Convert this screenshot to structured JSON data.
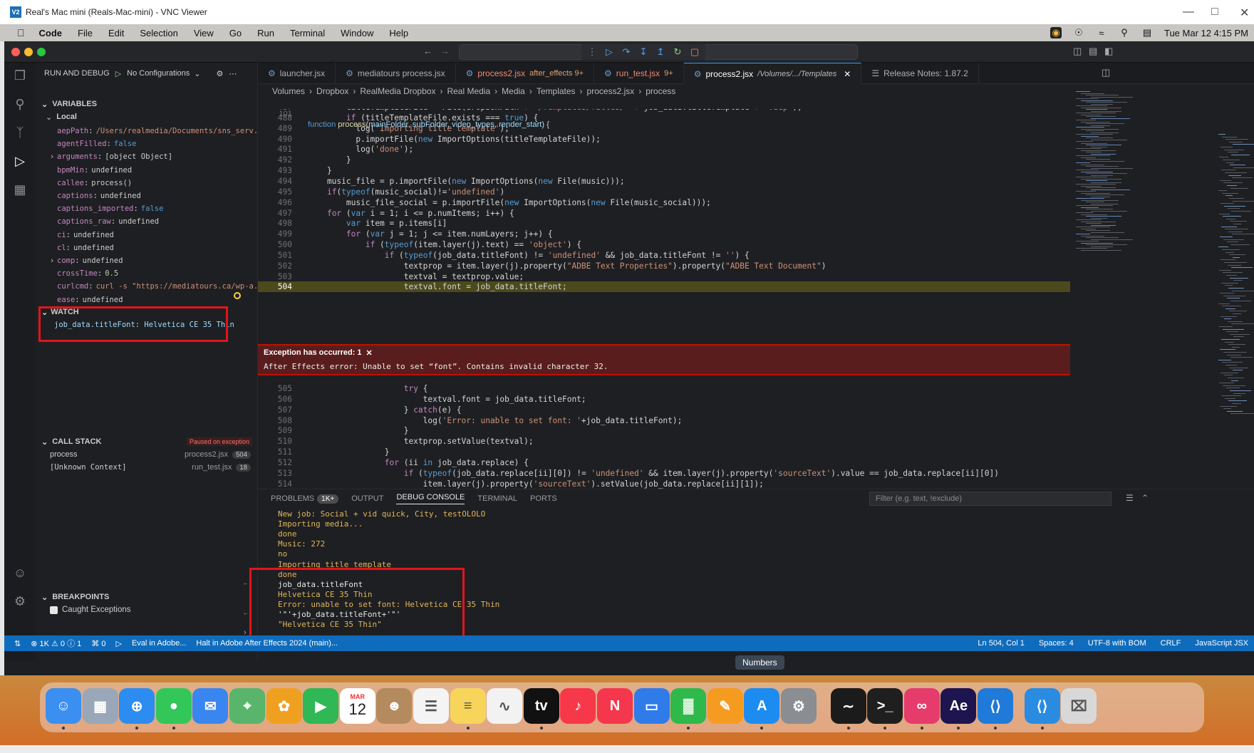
{
  "vnc": {
    "title": "Real's Mac mini (Reals-Mac-mini) - VNC Viewer",
    "logo": "V2"
  },
  "menubar": {
    "items": [
      "Code",
      "File",
      "Edit",
      "Selection",
      "View",
      "Go",
      "Run",
      "Terminal",
      "Window",
      "Help"
    ],
    "datetime": "Tue Mar 12  4:15 PM"
  },
  "sidebar": {
    "header": "RUN AND DEBUG",
    "config": "No Configurations",
    "variables_title": "VARIABLES",
    "local_title": "Local",
    "variables": [
      {
        "name": "aepPath",
        "value": "/Users/realmedia/Documents/sns_serv...",
        "kind": "str"
      },
      {
        "name": "agentFilled",
        "value": "false",
        "kind": "bool"
      },
      {
        "name": "arguments",
        "value": "[object Object]",
        "kind": "obj"
      },
      {
        "name": "bpmMin",
        "value": "undefined",
        "kind": "obj"
      },
      {
        "name": "callee",
        "value": "process()",
        "kind": "obj"
      },
      {
        "name": "captions",
        "value": "undefined",
        "kind": "obj"
      },
      {
        "name": "captions_imported",
        "value": "false",
        "kind": "bool"
      },
      {
        "name": "captions_raw",
        "value": "undefined",
        "kind": "obj"
      },
      {
        "name": "ci",
        "value": "undefined",
        "kind": "obj"
      },
      {
        "name": "cl",
        "value": "undefined",
        "kind": "obj"
      },
      {
        "name": "comp",
        "value": "undefined",
        "kind": "obj"
      },
      {
        "name": "crossTime",
        "value": "0.5",
        "kind": "num"
      },
      {
        "name": "curlcmd",
        "value": "curl -s \"https://mediatours.ca/wp-a...",
        "kind": "str"
      },
      {
        "name": "ease",
        "value": "undefined",
        "kind": "obj"
      }
    ],
    "watch_title": "WATCH",
    "watch_item": "job_data.titleFont: Helvetica CE 35 Thin",
    "callstack_title": "CALL STACK",
    "paused_label": "Paused on exception",
    "callstack": [
      {
        "name": "process",
        "file": "process2.jsx",
        "line": "504"
      },
      {
        "name": "[Unknown Context]",
        "file": "run_test.jsx",
        "line": "18"
      }
    ],
    "breakpoints_title": "BREAKPOINTS",
    "caught_exceptions": "Caught Exceptions"
  },
  "tabs": [
    {
      "label": "launcher.jsx",
      "sub": "",
      "err": false
    },
    {
      "label": "mediatours process.jsx",
      "sub": "",
      "err": false
    },
    {
      "label": "process2.jsx",
      "sub": "after_effects 9+",
      "err": true
    },
    {
      "label": "run_test.jsx",
      "sub": "9+",
      "err": true
    },
    {
      "label": "process2.jsx",
      "sub": "/Volumes/.../Templates",
      "err": false,
      "active": true
    },
    {
      "label": "Release Notes: 1.87.2",
      "sub": "",
      "err": false
    }
  ],
  "breadcrumb": [
    "Volumes",
    "Dropbox",
    "RealMedia Dropbox",
    "Real Media",
    "Media",
    "Templates",
    "process2.jsx",
    "process"
  ],
  "sticky_line": {
    "ln": "101",
    "html": "<span class='k'>function</span> <span class='fn'>process</span>(<span class='v'>mainFolder</span>, <span class='v'>subFolder</span>, <span class='v'>video_types</span>, <span class='v'>render_start</span>) {"
  },
  "code_lines": [
    {
      "ln": "487",
      "text": "        titleTemplateFile = File(dropboxPath + '/Templates/Titles/' + job_data.titleTemplate + '.aep');"
    },
    {
      "ln": "488",
      "text": ""
    },
    {
      "ln": "489",
      "text": "        if (titleTemplateFile.exists === true) {"
    },
    {
      "ln": "490",
      "text": "          log('Importing title template');"
    },
    {
      "ln": "491",
      "text": "          p.importFile(new ImportOptions(titleTemplateFile));"
    },
    {
      "ln": "492",
      "text": "          log('done');"
    },
    {
      "ln": "493",
      "text": "        }"
    },
    {
      "ln": "494",
      "text": "    }"
    },
    {
      "ln": "495",
      "text": "    music_file = p.importFile(new ImportOptions(new File(music)));"
    },
    {
      "ln": "496",
      "text": "    if(typeof(music_social)!='undefined')"
    },
    {
      "ln": "497",
      "text": "        music_file_social = p.importFile(new ImportOptions(new File(music_social)));"
    },
    {
      "ln": "498",
      "text": "    for (var i = 1; i <= p.numItems; i++) {"
    },
    {
      "ln": "499",
      "text": "        var item = p.items[i]"
    },
    {
      "ln": "500",
      "text": "        for (var j = 1; j <= item.numLayers; j++) {"
    },
    {
      "ln": "501",
      "text": "            if (typeof(item.layer(j).text) == 'object') {"
    },
    {
      "ln": "502",
      "text": "                if (typeof(job_data.titleFont) != 'undefined' && job_data.titleFont != '') {"
    },
    {
      "ln": "503",
      "text": "                    textprop = item.layer(j).property(\"ADBE Text Properties\").property(\"ADBE Text Document\")"
    },
    {
      "ln": "504",
      "text": "                    textval = textprop.value;"
    },
    {
      "ln": "505",
      "text": "                    textval.font = job_data.titleFont;"
    }
  ],
  "code_lines_after": [
    {
      "ln": "505",
      "text": "                    try {"
    },
    {
      "ln": "506",
      "text": "                        textval.font = job_data.titleFont;"
    },
    {
      "ln": "507",
      "text": "                    } catch(e) {"
    },
    {
      "ln": "508",
      "text": "                        log('Error: unable to set font: '+job_data.titleFont);"
    },
    {
      "ln": "509",
      "text": "                    }"
    },
    {
      "ln": "510",
      "text": "                    textprop.setValue(textval);"
    },
    {
      "ln": "511",
      "text": "                }"
    },
    {
      "ln": "512",
      "text": "                for (ii in job_data.replace) {"
    },
    {
      "ln": "513",
      "text": "                    if (typeof(job_data.replace[ii][0]) != 'undefined' && item.layer(j).property('sourceText').value == job_data.replace[ii][0])"
    },
    {
      "ln": "514",
      "text": "                        item.layer(j).property('sourceText').setValue(job_data.replace[ii][1]);"
    }
  ],
  "exception": {
    "title": "Exception has occurred: 1",
    "message": "After Effects error: Unable to set “font”. Contains invalid character 32."
  },
  "panel": {
    "tabs": [
      "PROBLEMS",
      "OUTPUT",
      "DEBUG CONSOLE",
      "TERMINAL",
      "PORTS"
    ],
    "problems_badge": "1K+",
    "filter_placeholder": "Filter (e.g. text, !exclude)",
    "console": [
      {
        "text": "New job: Social + vid quick, City, testOLOLO",
        "white": false
      },
      {
        "text": "Importing media...",
        "white": false
      },
      {
        "text": "done",
        "white": false
      },
      {
        "text": "Music: 272",
        "white": false
      },
      {
        "text": "no",
        "white": false
      },
      {
        "text": "Importing title template",
        "white": false
      },
      {
        "text": "done",
        "white": false
      },
      {
        "text": "job_data.titleFont",
        "white": true
      },
      {
        "text": "Helvetica CE 35 Thin",
        "white": false
      },
      {
        "text": "Error: unable to set font: Helvetica CE 35 Thin",
        "white": false
      },
      {
        "text": "'\"'+job_data.titleFont+'\"'",
        "white": true
      },
      {
        "text": "\"Helvetica CE 35 Thin\"",
        "white": false
      }
    ]
  },
  "status": {
    "problems": "⊗ 1K ⚠ 0 ⓘ 1",
    "ports": "0",
    "eval": "Eval in Adobe...",
    "halt": "Halt in Adobe After Effects 2024 (main)...",
    "ln_col": "Ln 504, Col 1",
    "spaces": "Spaces: 4",
    "encoding": "UTF-8 with BOM",
    "eol": "CRLF",
    "language": "JavaScript JSX"
  },
  "tooltip": "Numbers",
  "dock_calendar": {
    "month": "MAR",
    "day": "12"
  },
  "dock": [
    {
      "name": "finder",
      "color": "#3b8ff0",
      "glyph": "☺"
    },
    {
      "name": "launchpad",
      "color": "#9aa7b8",
      "glyph": "▦"
    },
    {
      "name": "safari",
      "color": "#2d8cf0",
      "glyph": "⊕"
    },
    {
      "name": "messages",
      "color": "#33c759",
      "glyph": "●"
    },
    {
      "name": "mail",
      "color": "#3a86f0",
      "glyph": "✉"
    },
    {
      "name": "maps",
      "color": "#58b56b",
      "glyph": "⌖"
    },
    {
      "name": "photos",
      "color": "#f0a020",
      "glyph": "✿"
    },
    {
      "name": "facetime",
      "color": "#2fb855",
      "glyph": "▶"
    },
    {
      "name": "calendar",
      "color": "#ffffff",
      "glyph": ""
    },
    {
      "name": "contacts",
      "color": "#b48a5f",
      "glyph": "☻"
    },
    {
      "name": "reminders",
      "color": "#f4f4f4",
      "glyph": "☰"
    },
    {
      "name": "notes",
      "color": "#f7d55b",
      "glyph": "≡"
    },
    {
      "name": "freeform",
      "color": "#f2f2f2",
      "glyph": "∿"
    },
    {
      "name": "tv",
      "color": "#111111",
      "glyph": "tv"
    },
    {
      "name": "music",
      "color": "#f6384a",
      "glyph": "♪"
    },
    {
      "name": "news",
      "color": "#f5374d",
      "glyph": "N"
    },
    {
      "name": "keynote",
      "color": "#2f7bea",
      "glyph": "▭"
    },
    {
      "name": "numbers",
      "color": "#2fb94a",
      "glyph": "▓"
    },
    {
      "name": "pages",
      "color": "#f59b20",
      "glyph": "✎"
    },
    {
      "name": "appstore",
      "color": "#1d8cf0",
      "glyph": "A"
    },
    {
      "name": "settings",
      "color": "#8a8d92",
      "glyph": "⚙"
    },
    {
      "name": "activity-monitor",
      "color": "#1b1b1b",
      "glyph": "∼"
    },
    {
      "name": "terminal",
      "color": "#1f1f1f",
      "glyph": ">_"
    },
    {
      "name": "creative-cloud",
      "color": "#e53c6c",
      "glyph": "∞"
    },
    {
      "name": "after-effects",
      "color": "#1e1450",
      "glyph": "Ae"
    },
    {
      "name": "vscode",
      "color": "#1f7ad9",
      "glyph": "⟨⟩"
    },
    {
      "name": "vscode-2",
      "color": "#2a8ce0",
      "glyph": "⟨⟩"
    },
    {
      "name": "trash",
      "color": "#d8d8d8",
      "glyph": "⌧"
    }
  ]
}
